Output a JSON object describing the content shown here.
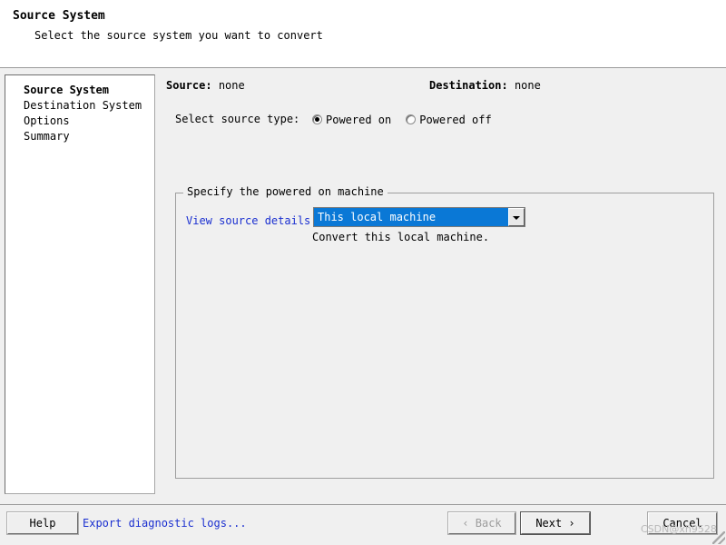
{
  "header": {
    "title": "Source System",
    "subtitle": "Select the source system you want to convert"
  },
  "sidebar": {
    "items": [
      {
        "label": "Source System",
        "active": true
      },
      {
        "label": "Destination System",
        "active": false
      },
      {
        "label": "Options",
        "active": false
      },
      {
        "label": "Summary",
        "active": false
      }
    ]
  },
  "main": {
    "source_label": "Source:",
    "source_value": "none",
    "destination_label": "Destination:",
    "destination_value": "none",
    "select_type_label": "Select source type:",
    "radios": [
      {
        "label": "Powered on",
        "checked": true
      },
      {
        "label": "Powered off",
        "checked": false
      }
    ],
    "combo": {
      "value": "This local machine",
      "arrow_icon": "chevron-down-icon"
    },
    "combo_hint": "Convert this local machine.",
    "fieldset_legend": "Specify the powered on machine",
    "view_source_details_link": "View source details..."
  },
  "footer": {
    "help_label": "Help",
    "export_logs_link": "Export diagnostic logs...",
    "back_label": "‹ Back",
    "next_label": "Next ›",
    "cancel_label": "Cancel"
  },
  "watermark": {
    "text": "CSDN@xh9528"
  },
  "colors": {
    "window_bg": "#f0f0f0",
    "panel_bg": "#ffffff",
    "selection_blue": "#0a78d6",
    "link_blue": "#1a2fd0",
    "border_gray": "#9a9a9a",
    "disabled_text": "#9d9d9d"
  }
}
